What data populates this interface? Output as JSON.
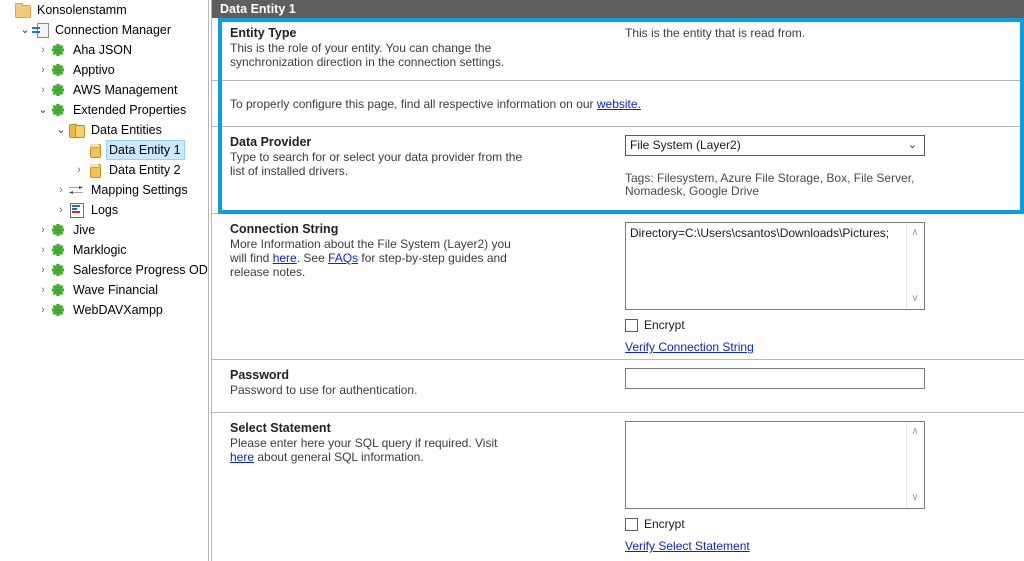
{
  "tree": {
    "items": [
      {
        "label": "Konsolenstamm",
        "indent": 0,
        "chev": "none",
        "icon": "folder-icon",
        "selected": false
      },
      {
        "label": "Connection Manager",
        "indent": 1,
        "chev": "open",
        "icon": "connection-manager-icon",
        "selected": false
      },
      {
        "label": "Aha JSON",
        "indent": 2,
        "chev": "closed",
        "icon": "connector-plug-icon",
        "selected": false
      },
      {
        "label": "Apptivo",
        "indent": 2,
        "chev": "closed",
        "icon": "connector-plug-icon",
        "selected": false
      },
      {
        "label": "AWS Management",
        "indent": 2,
        "chev": "closed",
        "icon": "connector-plug-icon",
        "selected": false
      },
      {
        "label": "Extended Properties",
        "indent": 2,
        "chev": "open",
        "icon": "connector-plug-icon",
        "selected": false
      },
      {
        "label": "Data Entities",
        "indent": 3,
        "chev": "open",
        "icon": "data-entities-icon",
        "selected": false
      },
      {
        "label": "Data Entity 1",
        "indent": 4,
        "chev": "none",
        "icon": "data-entity-icon",
        "selected": true
      },
      {
        "label": "Data Entity 2",
        "indent": 4,
        "chev": "closed",
        "icon": "data-entity-icon",
        "selected": false
      },
      {
        "label": "Mapping Settings",
        "indent": 3,
        "chev": "closed",
        "icon": "mapping-settings-icon",
        "selected": false
      },
      {
        "label": "Logs",
        "indent": 3,
        "chev": "closed",
        "icon": "logs-icon",
        "selected": false
      },
      {
        "label": "Jive",
        "indent": 2,
        "chev": "closed",
        "icon": "connector-plug-icon",
        "selected": false
      },
      {
        "label": "Marklogic",
        "indent": 2,
        "chev": "closed",
        "icon": "connector-plug-icon",
        "selected": false
      },
      {
        "label": "Salesforce Progress ODBC",
        "indent": 2,
        "chev": "closed",
        "icon": "connector-plug-icon",
        "selected": false
      },
      {
        "label": "Wave Financial",
        "indent": 2,
        "chev": "closed",
        "icon": "connector-plug-icon",
        "selected": false
      },
      {
        "label": "WebDAVXampp",
        "indent": 2,
        "chev": "closed",
        "icon": "connector-plug-icon",
        "selected": false
      }
    ],
    "chevron_open": "⌄",
    "chevron_closed": "›"
  },
  "titlebar": {
    "title": "Data Entity 1"
  },
  "entity_type": {
    "title": "Entity Type",
    "desc_line1": "This is the role of your entity. You can change the",
    "desc_line2": "synchronization direction in the connection settings.",
    "value": "This is the entity that is read from."
  },
  "info_row": {
    "text_before": "To properly configure this page, find all respective information on our ",
    "link": "website."
  },
  "data_provider": {
    "title": "Data Provider",
    "desc_line1": "Type to search for or select your data provider from the",
    "desc_line2": "list of installed drivers.",
    "selected": "File System (Layer2)",
    "caret": "⌄",
    "tags_line1": "Tags: Filesystem, Azure File Storage, Box, File Server,",
    "tags_line2": "Nomadesk, Google Drive"
  },
  "connection_string": {
    "title": "Connection String",
    "desc_part1": "More Information about the File System (Layer2) you",
    "desc_link1": "here",
    "desc_part2": ". See ",
    "desc_link2": "FAQs",
    "desc_part3": " for step-by-step guides and",
    "desc_part4": "release notes.",
    "desc_will_find": "will find ",
    "value": "Directory=C:\\Users\\csantos\\Downloads\\Pictures;",
    "encrypt_label": "Encrypt",
    "verify_label": "Verify Connection String",
    "scroll_up": "∧",
    "scroll_down": "∨"
  },
  "password": {
    "title": "Password",
    "desc": "Password to use for authentication.",
    "value": ""
  },
  "select_statement": {
    "title": "Select Statement",
    "desc_line1": "Please enter here your SQL query if required. Visit",
    "desc_link": "here",
    "desc_line2_rest": " about general SQL information.",
    "value": "",
    "encrypt_label": "Encrypt",
    "verify_label": "Verify Select Statement",
    "scroll_up": "∧",
    "scroll_down": "∨"
  },
  "colors": {
    "highlight": "#08a0e0",
    "titlebar": "#5f5f5f",
    "selection": "#cce8ff",
    "link": "#0a24d8",
    "connector_green": "#3fae2a"
  }
}
